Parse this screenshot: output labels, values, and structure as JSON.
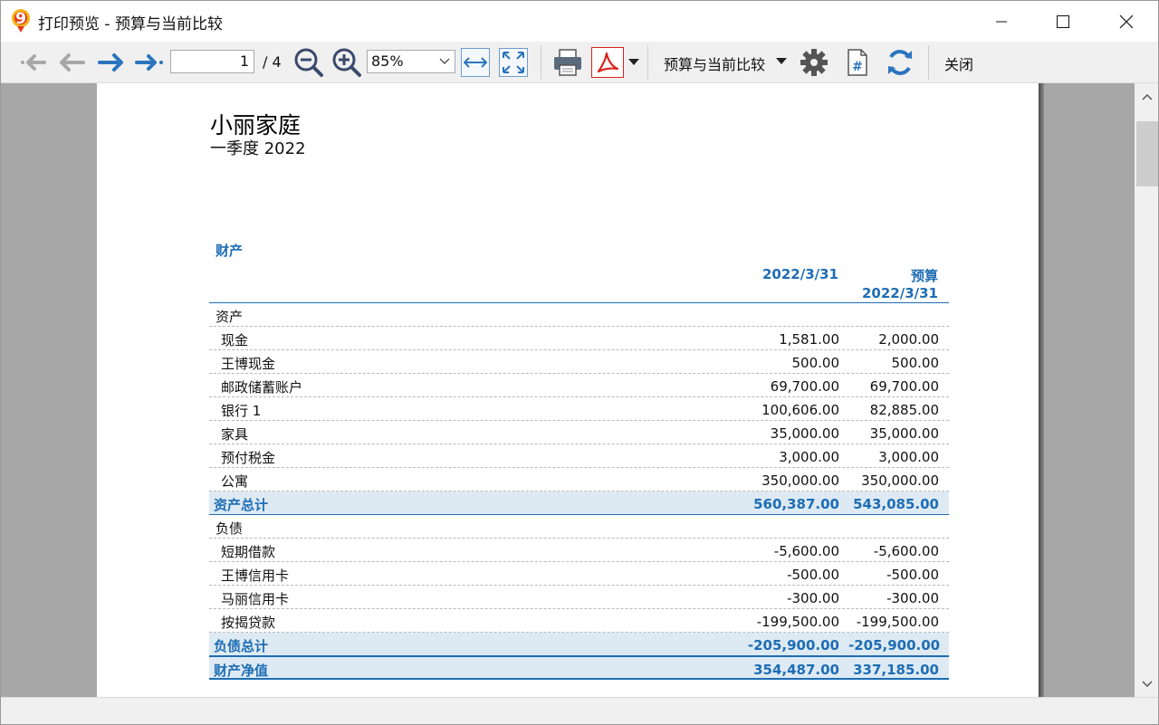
{
  "window": {
    "title": "打印预览 - 预算与当前比较"
  },
  "toolbar": {
    "page_current": "1",
    "page_total": "/ 4",
    "zoom_value": "85%",
    "report_name": "预算与当前比较",
    "close_label": "关闭",
    "icons": [
      "first-page-icon",
      "prev-page-icon",
      "next-page-icon",
      "last-page-icon",
      "zoom-out-icon",
      "zoom-in-icon",
      "fit-width-icon",
      "fit-page-icon",
      "print-icon",
      "pdf-icon",
      "settings-icon",
      "page-number-icon",
      "refresh-icon"
    ]
  },
  "report": {
    "title": "小丽家庭",
    "subtitle": "一季度 2022",
    "section": "财产",
    "col1_header": "2022/3/31",
    "col2_header_line1": "预算",
    "col2_header_line2": "2022/3/31",
    "rows": [
      {
        "type": "grp",
        "label": "资产",
        "v1": "",
        "v2": ""
      },
      {
        "type": "item",
        "label": "现金",
        "v1": "1,581.00",
        "v2": "2,000.00"
      },
      {
        "type": "item",
        "label": "王博现金",
        "v1": "500.00",
        "v2": "500.00"
      },
      {
        "type": "item",
        "label": "邮政储蓄账户",
        "v1": "69,700.00",
        "v2": "69,700.00"
      },
      {
        "type": "item",
        "label": "银行 1",
        "v1": "100,606.00",
        "v2": "82,885.00"
      },
      {
        "type": "item",
        "label": "家具",
        "v1": "35,000.00",
        "v2": "35,000.00"
      },
      {
        "type": "item",
        "label": "预付税金",
        "v1": "3,000.00",
        "v2": "3,000.00"
      },
      {
        "type": "item",
        "label": "公寓",
        "v1": "350,000.00",
        "v2": "350,000.00"
      },
      {
        "type": "total",
        "label": "资产总计",
        "v1": "560,387.00",
        "v2": "543,085.00"
      },
      {
        "type": "grp",
        "label": "负债",
        "v1": "",
        "v2": ""
      },
      {
        "type": "item",
        "label": "短期借款",
        "v1": "-5,600.00",
        "v2": "-5,600.00"
      },
      {
        "type": "item",
        "label": "王博信用卡",
        "v1": "-500.00",
        "v2": "-500.00"
      },
      {
        "type": "item",
        "label": "马丽信用卡",
        "v1": "-300.00",
        "v2": "-300.00"
      },
      {
        "type": "item",
        "label": "按揭贷款",
        "v1": "-199,500.00",
        "v2": "-199,500.00"
      },
      {
        "type": "total",
        "label": "负债总计",
        "v1": "-205,900.00",
        "v2": "-205,900.00"
      },
      {
        "type": "net",
        "label": "财产净值",
        "v1": "354,487.00",
        "v2": "337,185.00"
      }
    ]
  },
  "colors": {
    "accent": "#1d6db5",
    "total_fill": "#deeaf3",
    "viewport_bg": "#a7a7a7",
    "pdf_red": "#d9221c"
  }
}
